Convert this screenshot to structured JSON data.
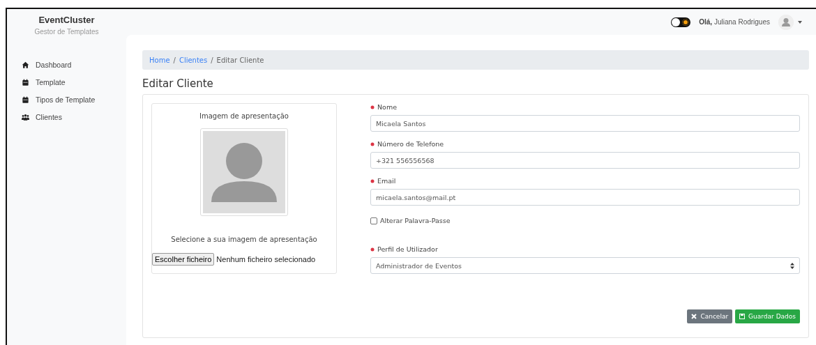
{
  "sidebar": {
    "brand": "EventCluster",
    "subtitle": "Gestor de Templates",
    "items": [
      {
        "label": "Dashboard",
        "kind": "home"
      },
      {
        "label": "Template",
        "kind": "calendar"
      },
      {
        "label": "Tipos de Template",
        "kind": "calendar"
      },
      {
        "label": "Clientes",
        "kind": "users"
      }
    ]
  },
  "header": {
    "theme_toggle": {
      "on": false
    },
    "greeting_bold": "Olá,",
    "user_name": "Juliana Rodrigues"
  },
  "breadcrumb_separator": "/",
  "breadcrumb": [
    {
      "label": "Home",
      "link": true
    },
    {
      "label": "Clientes",
      "link": true
    },
    {
      "label": "Editar Cliente",
      "link": false
    }
  ],
  "page_title": "Editar Cliente",
  "image_panel": {
    "title": "Imagem de apresentação",
    "hint": "Selecione a sua imagem de apresentação",
    "file_button": "Escolher ficheiro",
    "file_status": "Nenhum ficheiro selecionado"
  },
  "fields": [
    {
      "kind": "text",
      "label": "Nome",
      "value": "Micaela Santos"
    },
    {
      "kind": "text",
      "label": "Número de Telefone",
      "value": "+321 556556568"
    },
    {
      "kind": "text",
      "label": "Email",
      "value": "micaela.santos@mail.pt"
    },
    {
      "kind": "checkbox",
      "label": "Alterar Palavra-Passe",
      "checked": false
    },
    {
      "kind": "select",
      "label": "Perfil de Utilizador",
      "value": "Administrador de Eventos"
    }
  ],
  "buttons": [
    {
      "kind": "cancel",
      "label": "Cancelar"
    },
    {
      "kind": "save",
      "label": "Guardar Dados"
    }
  ]
}
